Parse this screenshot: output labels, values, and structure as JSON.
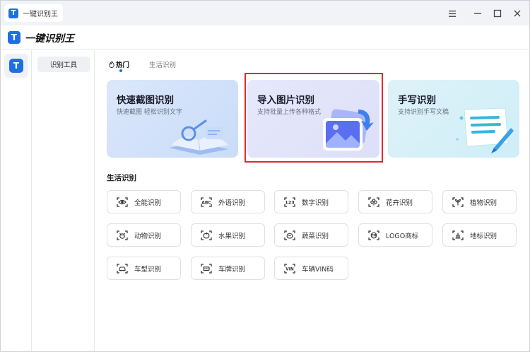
{
  "window": {
    "tab_title": "一键识别王",
    "logo_letter": "T"
  },
  "header": {
    "app_title": "一键识别王"
  },
  "menu": {
    "active_item": "识别工具"
  },
  "tabs": [
    {
      "label": "热门",
      "active": true
    },
    {
      "label": "生活识别",
      "active": false
    }
  ],
  "feature_cards": [
    {
      "title": "快速截图识别",
      "subtitle": "快速截图 轻松识别文字",
      "icon": "book-crop-icon"
    },
    {
      "title": "导入图片识别",
      "subtitle": "支持批量上传各种格式",
      "icon": "image-import-icon"
    },
    {
      "title": "手写识别",
      "subtitle": "支持识别手写文稿",
      "icon": "handwriting-paper-icon"
    }
  ],
  "life_section": {
    "title": "生活识别",
    "items": [
      {
        "label": "全能识别",
        "icon": "eye-scan-icon"
      },
      {
        "label": "外语识别",
        "icon": "abc-scan-icon"
      },
      {
        "label": "数字识别",
        "icon": "number-scan-icon"
      },
      {
        "label": "花卉识别",
        "icon": "flower-scan-icon"
      },
      {
        "label": "植物识别",
        "icon": "plant-scan-icon"
      },
      {
        "label": "动物识别",
        "icon": "animal-scan-icon"
      },
      {
        "label": "水果识别",
        "icon": "fruit-scan-icon"
      },
      {
        "label": "蔬菜识别",
        "icon": "vegetable-scan-icon"
      },
      {
        "label": "LOGO商标",
        "icon": "logo-scan-icon"
      },
      {
        "label": "地标识别",
        "icon": "landmark-scan-icon"
      },
      {
        "label": "车型识别",
        "icon": "car-scan-icon"
      },
      {
        "label": "车牌识别",
        "icon": "license-plate-scan-icon"
      },
      {
        "label": "车辆VIN码",
        "icon": "vin-scan-icon"
      }
    ]
  },
  "colors": {
    "brand": "#1f6fe0",
    "highlight_border": "#e0282e"
  }
}
